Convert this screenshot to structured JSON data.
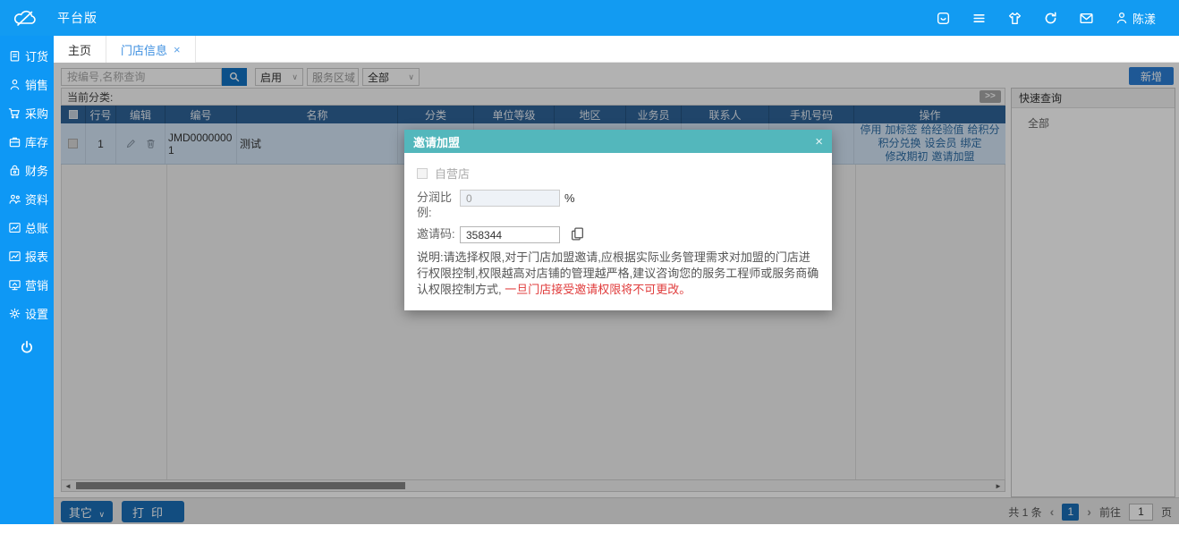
{
  "app": {
    "title": "平台版",
    "user": "陈漾"
  },
  "topbar": {
    "icons": [
      "workbench-icon",
      "menu-icon",
      "skin-icon",
      "refresh-icon",
      "message-icon",
      "user-icon"
    ]
  },
  "sidebar": {
    "items": [
      {
        "label": "订货",
        "icon": "order-icon"
      },
      {
        "label": "销售",
        "icon": "sales-icon"
      },
      {
        "label": "采购",
        "icon": "purchase-icon"
      },
      {
        "label": "库存",
        "icon": "inventory-icon"
      },
      {
        "label": "财务",
        "icon": "finance-icon"
      },
      {
        "label": "资料",
        "icon": "archives-icon"
      },
      {
        "label": "总账",
        "icon": "ledger-icon"
      },
      {
        "label": "报表",
        "icon": "report-icon"
      },
      {
        "label": "营销",
        "icon": "marketing-icon"
      },
      {
        "label": "设置",
        "icon": "settings-icon"
      }
    ],
    "power_icon": "power-icon"
  },
  "tabs": [
    {
      "label": "主页"
    },
    {
      "label": "门店信息",
      "close": "×"
    }
  ],
  "toolbar": {
    "search_placeholder": "按编号,名称查询",
    "filter_status": "启用",
    "filter_service_area": "服务区域",
    "filter_all": "全部",
    "add_label": "新增"
  },
  "category_bar": {
    "label": "当前分类:",
    "expand_label": ">>"
  },
  "table": {
    "headers": [
      "行号",
      "编辑",
      "编号",
      "名称",
      "分类",
      "单位等级",
      "地区",
      "业务员",
      "联系人",
      "手机号码",
      "操作"
    ],
    "rows": [
      {
        "row_no": "1",
        "code": "JMD00000001",
        "name": "测试",
        "category": "",
        "unit_level": "",
        "region": "",
        "salesman": "",
        "contact": "",
        "phone": "",
        "actions": [
          "停用",
          "加标签",
          "给经验值",
          "给积分",
          "积分兑换",
          "设会员",
          "绑定",
          "修改期初",
          "邀请加盟"
        ]
      }
    ]
  },
  "quick_search": {
    "title": "快速查询",
    "items": [
      "全部"
    ]
  },
  "modal": {
    "title": "邀请加盟",
    "close": "×",
    "self_store_label": "自营店",
    "profit_label": "分润比例:",
    "profit_value": "0",
    "percent_suffix": "%",
    "invite_label": "邀请码:",
    "invite_code": "358344",
    "description": "说明:请选择权限,对于门店加盟邀请,应根据实际业务管理需求对加盟的门店进行权限控制,权限越高对店铺的管理越严格,建议咨询您的服务工程师或服务商确认权限控制方式,",
    "warning": "一旦门店接受邀请权限将不可更改。"
  },
  "footer": {
    "other_label": "其它",
    "print_label": "打印",
    "total": "共 1 条",
    "page": "1",
    "goto_label": "前往",
    "goto_value": "1",
    "page_unit": "页"
  },
  "colors": {
    "accent_blue": "#129BF2",
    "table_header": "#2E6399",
    "modal_header": "#53B7BC",
    "button_blue": "#1B6FB8",
    "add_button": "#2B7FD6",
    "warning_red": "#E03C3C",
    "selected_row": "#D4E6F6"
  }
}
